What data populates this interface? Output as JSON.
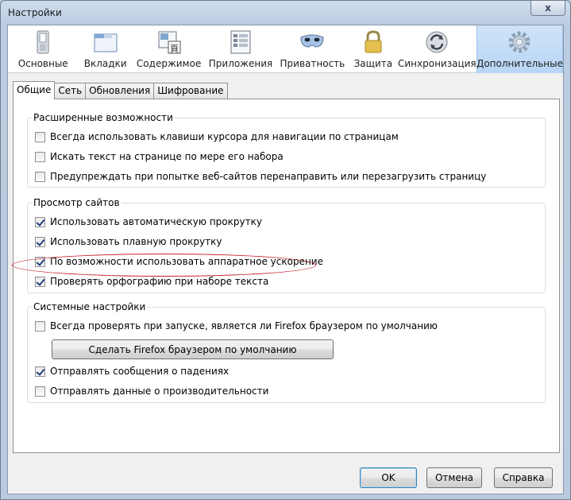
{
  "window": {
    "title": "Настройки",
    "close_glyph": "x"
  },
  "panes": [
    {
      "label": "Основные",
      "icon": "switch-icon"
    },
    {
      "label": "Вкладки",
      "icon": "tabs-window-icon"
    },
    {
      "label": "Содержимое",
      "icon": "content-icon"
    },
    {
      "label": "Приложения",
      "icon": "applications-icon"
    },
    {
      "label": "Приватность",
      "icon": "mask-icon"
    },
    {
      "label": "Защита",
      "icon": "padlock-icon"
    },
    {
      "label": "Синхронизация",
      "icon": "sync-icon"
    },
    {
      "label": "Дополнительные",
      "icon": "gear-icon",
      "selected": true
    }
  ],
  "tabs": [
    {
      "label": "Общие",
      "active": true
    },
    {
      "label": "Сеть"
    },
    {
      "label": "Обновления"
    },
    {
      "label": "Шифрование"
    }
  ],
  "groups": {
    "accessibility": {
      "title": "Расширенные возможности",
      "items": [
        {
          "label": "Всегда использовать клавиши курсора для навигации по страницам",
          "checked": false
        },
        {
          "label": "Искать текст на странице по мере его набора",
          "checked": false
        },
        {
          "label": "Предупреждать при попытке веб-сайтов перенаправить или перезагрузить страницу",
          "checked": false
        }
      ]
    },
    "browsing": {
      "title": "Просмотр сайтов",
      "items": [
        {
          "label": "Использовать автоматическую прокрутку",
          "checked": true
        },
        {
          "label": "Использовать плавную прокрутку",
          "checked": true
        },
        {
          "label": "По возможности использовать аппаратное ускорение",
          "checked": true
        },
        {
          "label": "Проверять орфографию при наборе текста",
          "checked": true
        }
      ]
    },
    "system": {
      "title": "Системные настройки",
      "check_default": {
        "label": "Всегда проверять при запуске, является ли Firefox браузером по умолчанию",
        "checked": false
      },
      "default_button": "Сделать Firefox браузером по умолчанию",
      "items": [
        {
          "label": "Отправлять сообщения о падениях",
          "checked": true
        },
        {
          "label": "Отправлять данные о производительности",
          "checked": false
        }
      ]
    }
  },
  "footer": {
    "ok": "OK",
    "cancel": "Отмена",
    "help": "Справка"
  },
  "colors": {
    "annotation": "#c6232f",
    "selected_pane": "#b8d6f6"
  }
}
